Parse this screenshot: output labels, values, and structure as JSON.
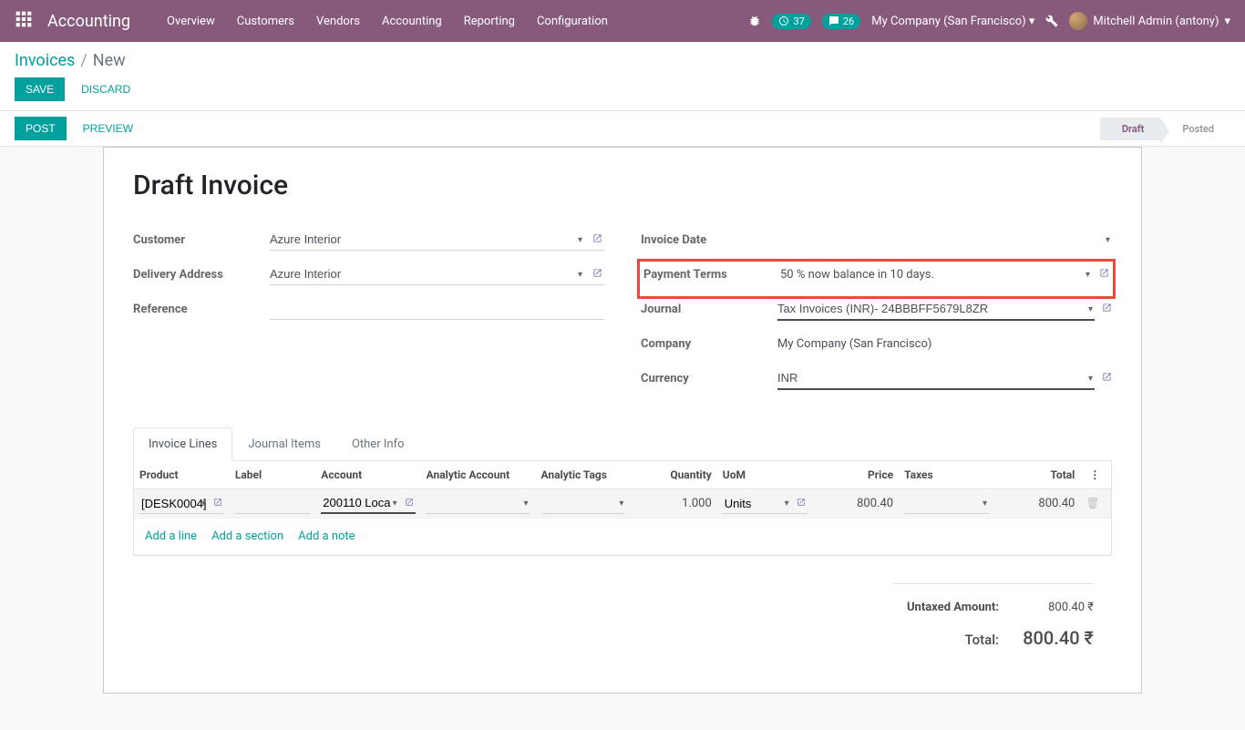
{
  "navbar": {
    "app_name": "Accounting",
    "menu": [
      "Overview",
      "Customers",
      "Vendors",
      "Accounting",
      "Reporting",
      "Configuration"
    ],
    "activities_count": "37",
    "messages_count": "26",
    "company": "My Company (San Francisco)",
    "user": "Mitchell Admin (antony)"
  },
  "breadcrumb": {
    "parent": "Invoices",
    "current": "New"
  },
  "buttons": {
    "save": "Save",
    "discard": "Discard",
    "post": "Post",
    "preview": "Preview"
  },
  "status": {
    "draft": "Draft",
    "posted": "Posted"
  },
  "form": {
    "title": "Draft Invoice",
    "labels": {
      "customer": "Customer",
      "delivery_address": "Delivery Address",
      "reference": "Reference",
      "invoice_date": "Invoice Date",
      "payment_terms": "Payment Terms",
      "journal": "Journal",
      "company": "Company",
      "currency": "Currency"
    },
    "values": {
      "customer": "Azure Interior",
      "delivery_address": "Azure Interior",
      "reference": "",
      "invoice_date": "",
      "payment_terms": "50 % now balance in 10 days.",
      "journal": "Tax Invoices (INR)- 24BBBFF5679L8ZR",
      "company": "My Company (San Francisco)",
      "currency": "INR"
    }
  },
  "tabs": {
    "invoice_lines": "Invoice Lines",
    "journal_items": "Journal Items",
    "other_info": "Other Info"
  },
  "table": {
    "headers": {
      "product": "Product",
      "label": "Label",
      "account": "Account",
      "analytic_account": "Analytic Account",
      "analytic_tags": "Analytic Tags",
      "quantity": "Quantity",
      "uom": "UoM",
      "price": "Price",
      "taxes": "Taxes",
      "total": "Total"
    },
    "row": {
      "product": "[DESK0004]",
      "label": "",
      "account": "200110 Loca",
      "analytic_account": "",
      "analytic_tags": "",
      "quantity": "1.000",
      "uom": "Units",
      "price": "800.40",
      "taxes": "",
      "total": "800.40"
    },
    "actions": {
      "add_line": "Add a line",
      "add_section": "Add a section",
      "add_note": "Add a note"
    }
  },
  "totals": {
    "untaxed_label": "Untaxed Amount:",
    "untaxed_value": "800.40 ₹",
    "total_label": "Total:",
    "total_value": "800.40 ₹"
  }
}
